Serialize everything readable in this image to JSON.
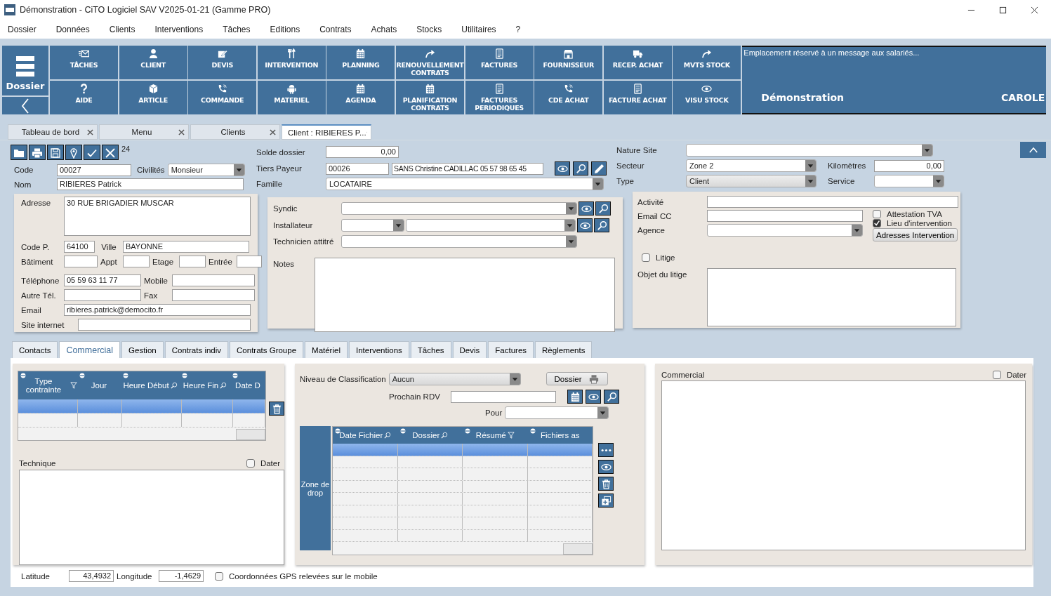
{
  "window": {
    "title": "Démonstration - CiTO Logiciel SAV  V2025-01-21 (Gamme PRO)"
  },
  "menu": [
    "Dossier",
    "Données",
    "Clients",
    "Interventions",
    "Tâches",
    "Editions",
    "Contrats",
    "Achats",
    "Stocks",
    "Utilitaires",
    "?"
  ],
  "toolbar": {
    "dossier": "Dossier",
    "buttons": [
      "TÂCHES",
      "CLIENT",
      "DEVIS",
      "INTERVENTION",
      "PLANNING",
      "RENOUVELLEMENT CONTRATS",
      "FACTURES",
      "FOURNISSEUR",
      "RECEP. ACHAT",
      "MVTS STOCK",
      "AIDE",
      "ARTICLE",
      "COMMANDE",
      "MATERIEL",
      "AGENDA",
      "PLANIFICATION CONTRATS",
      "FACTURES PERIODIQUES",
      "CDE ACHAT",
      "FACTURE ACHAT",
      "VISU STOCK"
    ]
  },
  "message_panel": {
    "message": "Emplacement réservé à un  message aux salariés...",
    "company": "Démonstration",
    "user": "CAROLE"
  },
  "doc_tabs": [
    {
      "label": "Tableau de bord",
      "selected": false
    },
    {
      "label": "Menu",
      "selected": false
    },
    {
      "label": "Clients",
      "selected": false
    },
    {
      "label": "Client : RIBIERES P...",
      "selected": true
    }
  ],
  "record_count": "24",
  "header_left": {
    "code": {
      "label": "Code",
      "value": "00027"
    },
    "civilite": {
      "label": "Civilités",
      "value": "Monsieur"
    },
    "nom": {
      "label": "Nom",
      "value": "RIBIERES Patrick"
    }
  },
  "header_mid": {
    "solde": {
      "label": "Solde dossier",
      "value": "0,00"
    },
    "tiers_payeur": {
      "label": "Tiers Payeur",
      "code": "00026",
      "name": "SANS Christine CADILLAC 05 57 98 65 45"
    },
    "famille": {
      "label": "Famille",
      "value": "LOCATAIRE"
    }
  },
  "header_right": {
    "nature_site": {
      "label": "Nature Site"
    },
    "secteur": {
      "label": "Secteur",
      "value": "Zone 2"
    },
    "kilometres": {
      "label": "Kilomètres",
      "value": "0,00"
    },
    "type": {
      "label": "Type",
      "value": "Client"
    },
    "service": {
      "label": "Service"
    }
  },
  "address": {
    "adresse": {
      "label": "Adresse",
      "value": "30 RUE BRIGADIER MUSCAR"
    },
    "code_postal": {
      "label": "Code P.",
      "value": "64100"
    },
    "ville": {
      "label": "Ville",
      "value": "BAYONNE"
    },
    "batiment": {
      "label": "Bâtiment"
    },
    "appt": {
      "label": "Appt"
    },
    "etage": {
      "label": "Etage"
    },
    "entree": {
      "label": "Entrée"
    },
    "telephone": {
      "label": "Téléphone",
      "value": "05 59 63 11 77"
    },
    "mobile": {
      "label": "Mobile"
    },
    "autre_tel": {
      "label": "Autre Tél."
    },
    "fax": {
      "label": "Fax"
    },
    "email": {
      "label": "Email",
      "value": "ribieres.patrick@democito.fr"
    },
    "site": {
      "label": "Site internet"
    }
  },
  "relations": {
    "syndic": {
      "label": "Syndic"
    },
    "installateur": {
      "label": "Installateur"
    },
    "technicien": {
      "label": "Technicien attitré"
    },
    "notes": {
      "label": "Notes"
    }
  },
  "details": {
    "activite": {
      "label": "Activité"
    },
    "email_cc": {
      "label": "Email CC"
    },
    "agence": {
      "label": "Agence"
    },
    "attestation_tva": {
      "label": "Attestation TVA",
      "checked": false
    },
    "lieu_intervention": {
      "label": "Lieu d'intervention",
      "checked": true
    },
    "adresses_button": "Adresses Intervention",
    "litige": {
      "label": "Litige",
      "checked": false
    },
    "objet_litige": {
      "label": "Objet du litige"
    }
  },
  "sub_tabs": [
    {
      "label": "Contacts",
      "selected": false
    },
    {
      "label": "Commercial",
      "selected": true
    },
    {
      "label": "Gestion",
      "selected": false
    },
    {
      "label": "Contrats indiv",
      "selected": false
    },
    {
      "label": "Contrats Groupe",
      "selected": false
    },
    {
      "label": "Matériel",
      "selected": false
    },
    {
      "label": "Interventions",
      "selected": false
    },
    {
      "label": "Tâches",
      "selected": false
    },
    {
      "label": "Devis",
      "selected": false
    },
    {
      "label": "Factures",
      "selected": false
    },
    {
      "label": "Règlements",
      "selected": false
    }
  ],
  "constraints": {
    "columns": [
      "Type contrainte",
      "Jour",
      "Heure Début",
      "Heure Fin",
      "Date D"
    ],
    "rows": [
      {
        "selected": true
      },
      {
        "selected": false
      }
    ]
  },
  "technique": {
    "label": "Technique",
    "dater": {
      "label": "Dater",
      "checked": false
    }
  },
  "gps": {
    "latitude": {
      "label": "Latitude",
      "value": "43,4932"
    },
    "longitude": {
      "label": "Longitude",
      "value": "-1,4629"
    },
    "mobile_gps": {
      "label": "Coordonnées GPS relevées sur le mobile",
      "checked": false
    }
  },
  "classification": {
    "label": "Niveau de Classification",
    "value": "Aucun"
  },
  "dossier_button": "Dossier",
  "prochain_rdv": {
    "label": "Prochain RDV"
  },
  "pour": {
    "label": "Pour"
  },
  "drop_zone": "Zone de drop",
  "files": {
    "columns": [
      "Date Fichier",
      "Dossier",
      "Résumé",
      "Fichiers as"
    ],
    "rows": [
      {
        "selected": true
      },
      {
        "selected": false
      },
      {
        "selected": false
      },
      {
        "selected": false
      },
      {
        "selected": false
      },
      {
        "selected": false
      },
      {
        "selected": false
      },
      {
        "selected": false
      }
    ]
  },
  "commercial": {
    "label": "Commercial",
    "dater": {
      "label": "Dater",
      "checked": false
    }
  }
}
